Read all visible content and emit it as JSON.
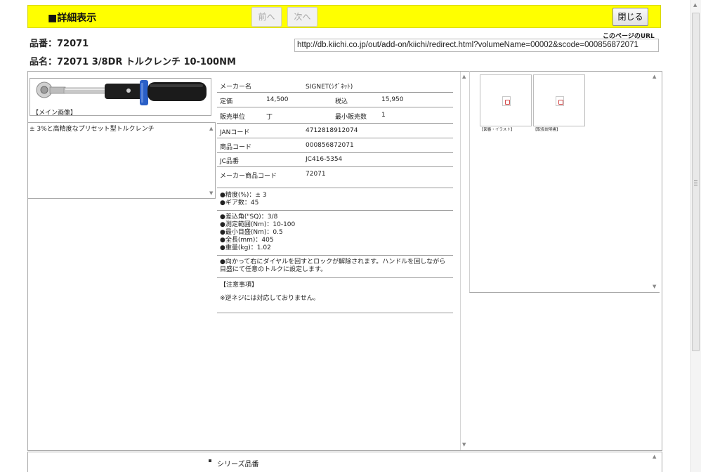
{
  "header": {
    "title": "■詳細表示",
    "prev_label": "前へ",
    "next_label": "次へ",
    "close_label": "閉じる"
  },
  "product": {
    "hinban": "品番：72071",
    "hinmei": "品名：72071 3/8DR トルクレンチ 10-100NM"
  },
  "page_url": {
    "label": "このページのURL",
    "value": "http://db.kiichi.co.jp/out/add-on/kiichi/redirect.html?volumeName=00002&scode=000856872071"
  },
  "main_image": {
    "caption": "【メイン画像】"
  },
  "description": "± 3%と高精度なプリセット型トルクレンチ",
  "info": {
    "maker_label": "メーカー名",
    "maker_value": "SIGNET(ｼｸﾞﾈｯﾄ)",
    "list_price_label": "定価",
    "list_price_value": "14,500",
    "tax_label": "税込",
    "tax_value": "15,950",
    "unit_label": "販売単位",
    "unit_value": "丁",
    "min_qty_label": "最小販売数",
    "min_qty_value": "1",
    "jan_label": "JANコード",
    "jan_value": "4712818912074",
    "product_code_label": "商品コード",
    "product_code_value": "000856872071",
    "jc_label": "JC品番",
    "jc_value": "JC416-5354",
    "maker_code_label": "メーカー商品コード",
    "maker_code_value": "72071"
  },
  "specs_1": [
    "●精度(%)：± 3",
    "●ギア数：45"
  ],
  "specs_2": [
    "●差込角(\"SQ)：3/8",
    "●測定範囲(Nm)：10-100",
    "●最小目盛(Nm)：0.5",
    "●全長(mm)：405",
    "●重量(kg)：1.02"
  ],
  "usage": "●向かって右にダイヤルを回すとロックが解除されます。ハンドルを回しながら目盛にて任意のトルクに設定します。",
  "notes_title": "【注意事項】",
  "notes_text": "※逆ネジには対応しておりません。",
  "thumbnails": [
    {
      "caption": "【図番・イラスト】"
    },
    {
      "caption": "【取扱説明書】"
    }
  ],
  "series_label": "シリーズ品番",
  "colors": {
    "topbar": "#ffff00",
    "brand_blue": "#2a5fc6",
    "handle_black": "#1b1b1b"
  }
}
